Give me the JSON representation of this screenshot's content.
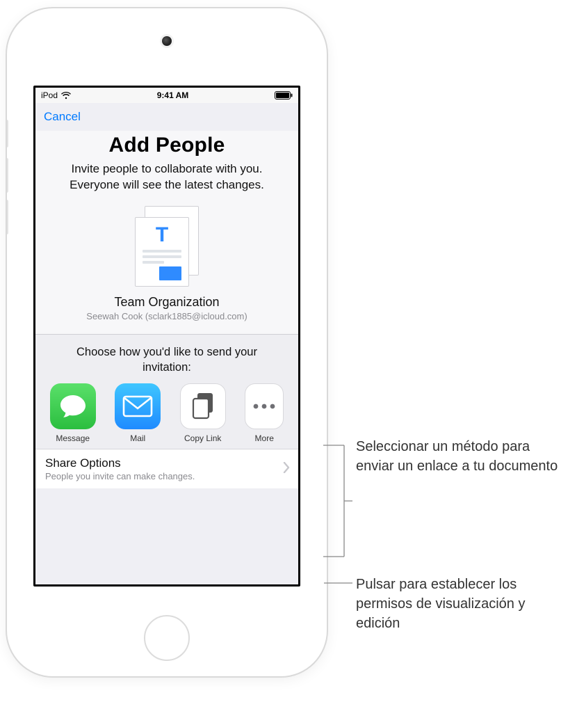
{
  "statusbar": {
    "device": "iPod",
    "time": "9:41 AM"
  },
  "nav": {
    "cancel": "Cancel"
  },
  "header": {
    "title": "Add People",
    "subtitle": "Invite people to collaborate with you. Everyone will see the latest changes."
  },
  "document": {
    "name": "Team Organization",
    "owner": "Seewah Cook (sclark1885@icloud.com)"
  },
  "invite": {
    "prompt": "Choose how you'd like to send your invitation:",
    "methods": [
      {
        "label": "Message"
      },
      {
        "label": "Mail"
      },
      {
        "label": "Copy Link"
      },
      {
        "label": "More"
      }
    ]
  },
  "share_options": {
    "title": "Share Options",
    "subtitle": "People you invite can make changes."
  },
  "callouts": {
    "send_method": "Seleccionar un método para enviar un enlace a tu documento",
    "permissions": "Pulsar para establecer los permisos de visualización y edición"
  }
}
